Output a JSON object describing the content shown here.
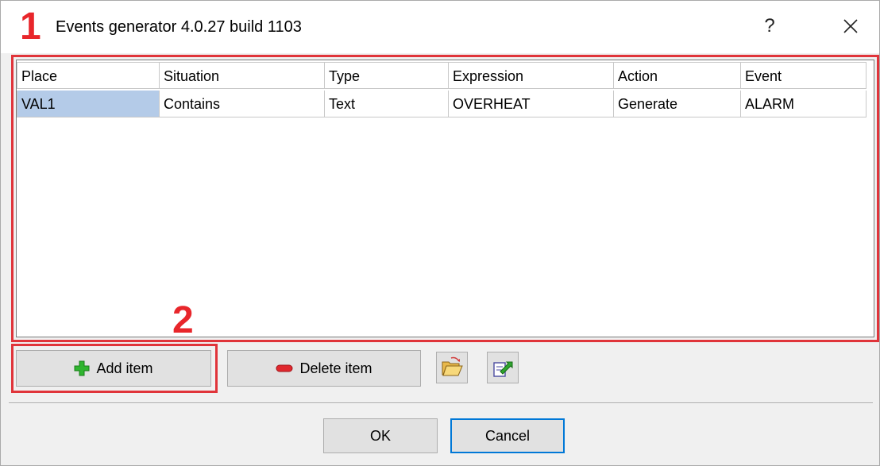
{
  "window": {
    "title": "Events generator 4.0.27 build 1103",
    "help_label": "?"
  },
  "callouts": {
    "one": "1",
    "two": "2"
  },
  "grid": {
    "columns": [
      "Place",
      "Situation",
      "Type",
      "Expression",
      "Action",
      "Event"
    ],
    "rows": [
      [
        "VAL1",
        "Contains",
        "Text",
        "OVERHEAT",
        "Generate",
        "ALARM"
      ]
    ]
  },
  "toolbar": {
    "add_label": "Add item",
    "delete_label": "Delete item",
    "open_icon": "folder-open-icon",
    "export_icon": "export-icon"
  },
  "footer": {
    "ok_label": "OK",
    "cancel_label": "Cancel"
  },
  "colors": {
    "callout": "#e8262b",
    "selection": "#b4cbe8",
    "focus_border": "#0078d7",
    "add_icon": "#2fb52f",
    "delete_icon": "#e0282e"
  }
}
